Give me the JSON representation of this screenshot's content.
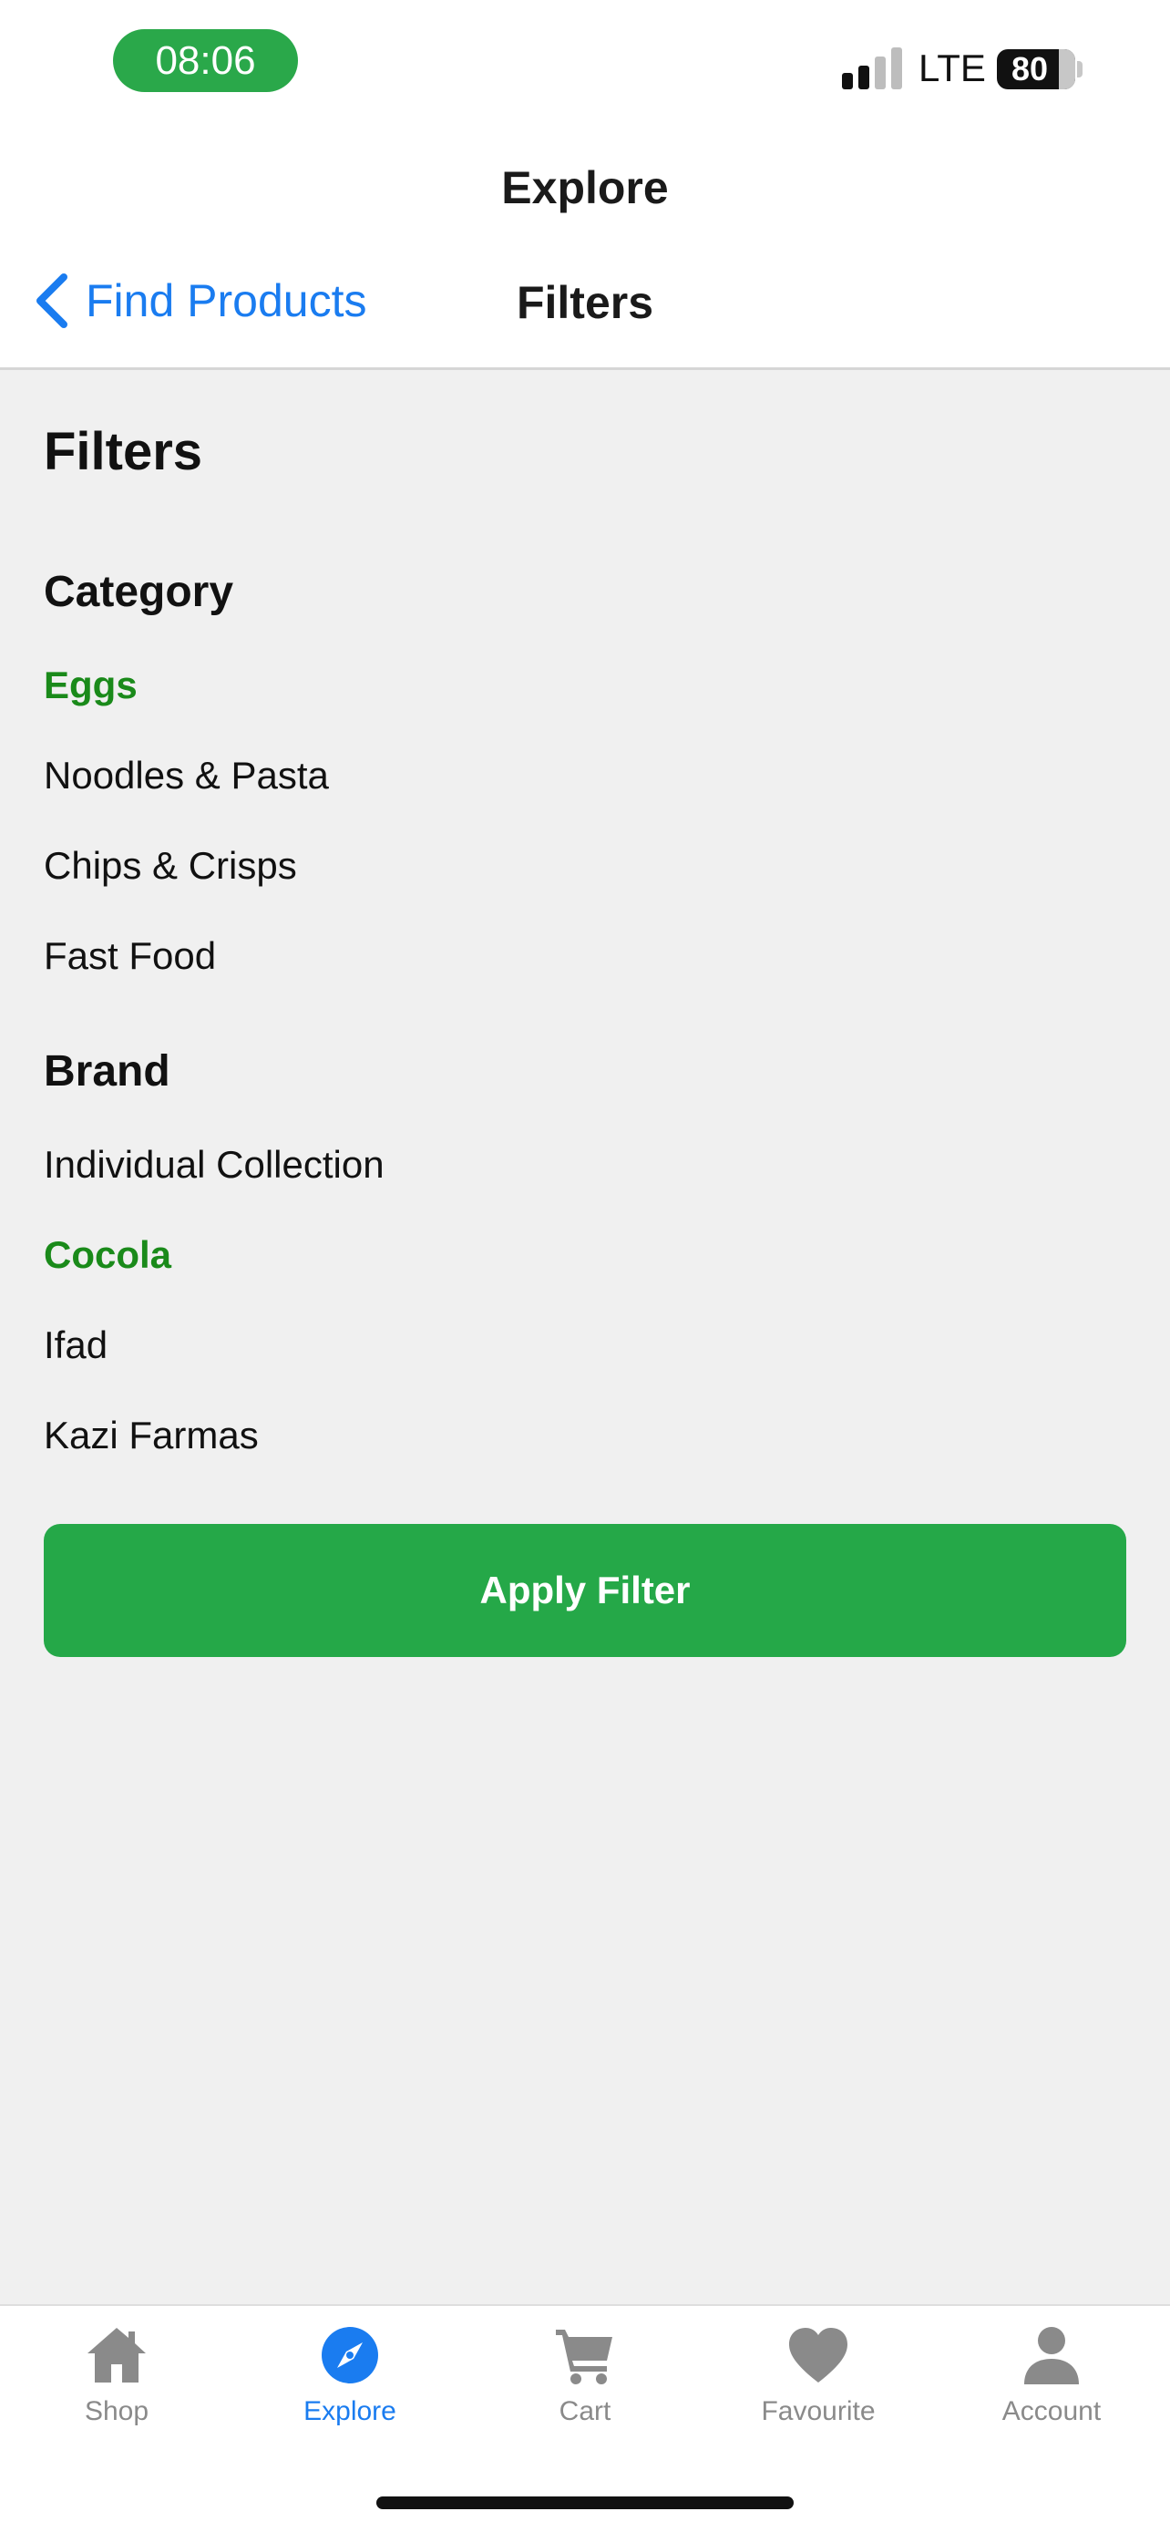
{
  "status_bar": {
    "time": "08:06",
    "network": "LTE",
    "battery_level": "80",
    "signal_bars_active": 2,
    "signal_bars_total": 4
  },
  "header": {
    "nav_title": "Explore",
    "back_label": "Find Products",
    "screen_title": "Filters"
  },
  "page": {
    "heading": "Filters"
  },
  "category": {
    "heading": "Category",
    "options": [
      {
        "label": "Eggs",
        "selected": true
      },
      {
        "label": "Noodles & Pasta",
        "selected": false
      },
      {
        "label": "Chips & Crisps",
        "selected": false
      },
      {
        "label": "Fast Food",
        "selected": false
      }
    ]
  },
  "brand": {
    "heading": "Brand",
    "options": [
      {
        "label": "Individual Collection",
        "selected": false
      },
      {
        "label": "Cocola",
        "selected": true
      },
      {
        "label": "Ifad",
        "selected": false
      },
      {
        "label": "Kazi Farmas",
        "selected": false
      }
    ]
  },
  "apply_button": {
    "label": "Apply Filter"
  },
  "tab_bar": {
    "tabs": [
      {
        "label": "Shop",
        "icon": "house-icon",
        "active": false
      },
      {
        "label": "Explore",
        "icon": "compass-icon",
        "active": true
      },
      {
        "label": "Cart",
        "icon": "cart-icon",
        "active": false
      },
      {
        "label": "Favourite",
        "icon": "heart-icon",
        "active": false
      },
      {
        "label": "Account",
        "icon": "person-icon",
        "active": false
      }
    ]
  },
  "colors": {
    "accent_blue": "#1a7cf0",
    "selected_green": "#1a8a1a",
    "button_green": "#25a848",
    "time_pill_green": "#2aa84a",
    "inactive_gray": "#8a8a8a",
    "background": "#f0f0f0"
  }
}
